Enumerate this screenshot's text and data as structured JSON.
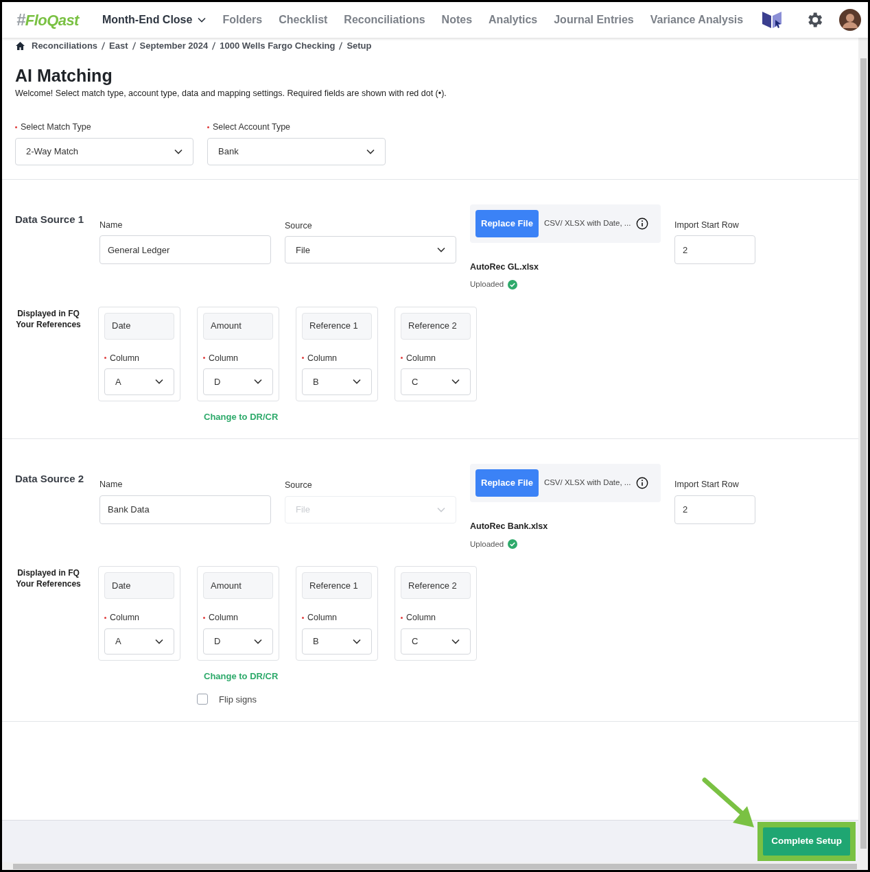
{
  "logo": {
    "mark": "#",
    "text": "FloQast"
  },
  "nav": [
    {
      "label": "Month-End Close",
      "kind": "dropdown"
    },
    {
      "label": "Folders",
      "kind": "link"
    },
    {
      "label": "Checklist",
      "kind": "link"
    },
    {
      "label": "Reconciliations",
      "kind": "link"
    },
    {
      "label": "Notes",
      "kind": "link"
    },
    {
      "label": "Analytics",
      "kind": "link"
    },
    {
      "label": "Journal Entries",
      "kind": "link"
    },
    {
      "label": "Variance Analysis",
      "kind": "link"
    }
  ],
  "breadcrumb": [
    "Reconciliations",
    "East",
    "September 2024",
    "1000 Wells Fargo Checking",
    "Setup"
  ],
  "title": "AI Matching",
  "subtitle": "Welcome! Select match type, account type, data and mapping settings. Required fields are shown with red dot (•).",
  "selects": [
    {
      "label": "Select Match Type",
      "value": "2-Way Match",
      "required": true
    },
    {
      "label": "Select Account Type",
      "value": "Bank",
      "required": true
    }
  ],
  "data_sources": [
    {
      "title": "Data Source 1",
      "name_label": "Name",
      "name_value": "General Ledger",
      "source_label": "Source",
      "source_value": "File",
      "source_disabled": false,
      "replace_button": "Replace File",
      "file_hint": "CSV/ XLSX with Date, ...",
      "start_row_label": "Import Start Row",
      "start_row": "2",
      "file_name": "AutoRec GL.xlsx",
      "status": "Uploaded",
      "references_label": [
        "Displayed in FQ",
        "Your References"
      ],
      "mappings": [
        {
          "name": "Date",
          "column_label": "Column",
          "column": "A"
        },
        {
          "name": "Amount",
          "column_label": "Column",
          "column": "D"
        },
        {
          "name": "Reference 1",
          "column_label": "Column",
          "column": "B"
        },
        {
          "name": "Reference 2",
          "column_label": "Column",
          "column": "C"
        }
      ],
      "change_link": "Change to DR/CR"
    },
    {
      "title": "Data Source 2",
      "name_label": "Name",
      "name_value": "Bank Data",
      "source_label": "Source",
      "source_value": "File",
      "source_disabled": true,
      "replace_button": "Replace File",
      "file_hint": "CSV/ XLSX with Date, ...",
      "start_row_label": "Import Start Row",
      "start_row": "2",
      "file_name": "AutoRec Bank.xlsx",
      "status": "Uploaded",
      "references_label": [
        "Displayed in FQ",
        "Your References"
      ],
      "mappings": [
        {
          "name": "Date",
          "column_label": "Column",
          "column": "A"
        },
        {
          "name": "Amount",
          "column_label": "Column",
          "column": "D"
        },
        {
          "name": "Reference 1",
          "column_label": "Column",
          "column": "B"
        },
        {
          "name": "Reference 2",
          "column_label": "Column",
          "column": "C"
        }
      ],
      "change_link": "Change to DR/CR",
      "flip_signs": {
        "label": "Flip signs",
        "checked": false
      }
    }
  ],
  "complete_button": "Complete Setup"
}
